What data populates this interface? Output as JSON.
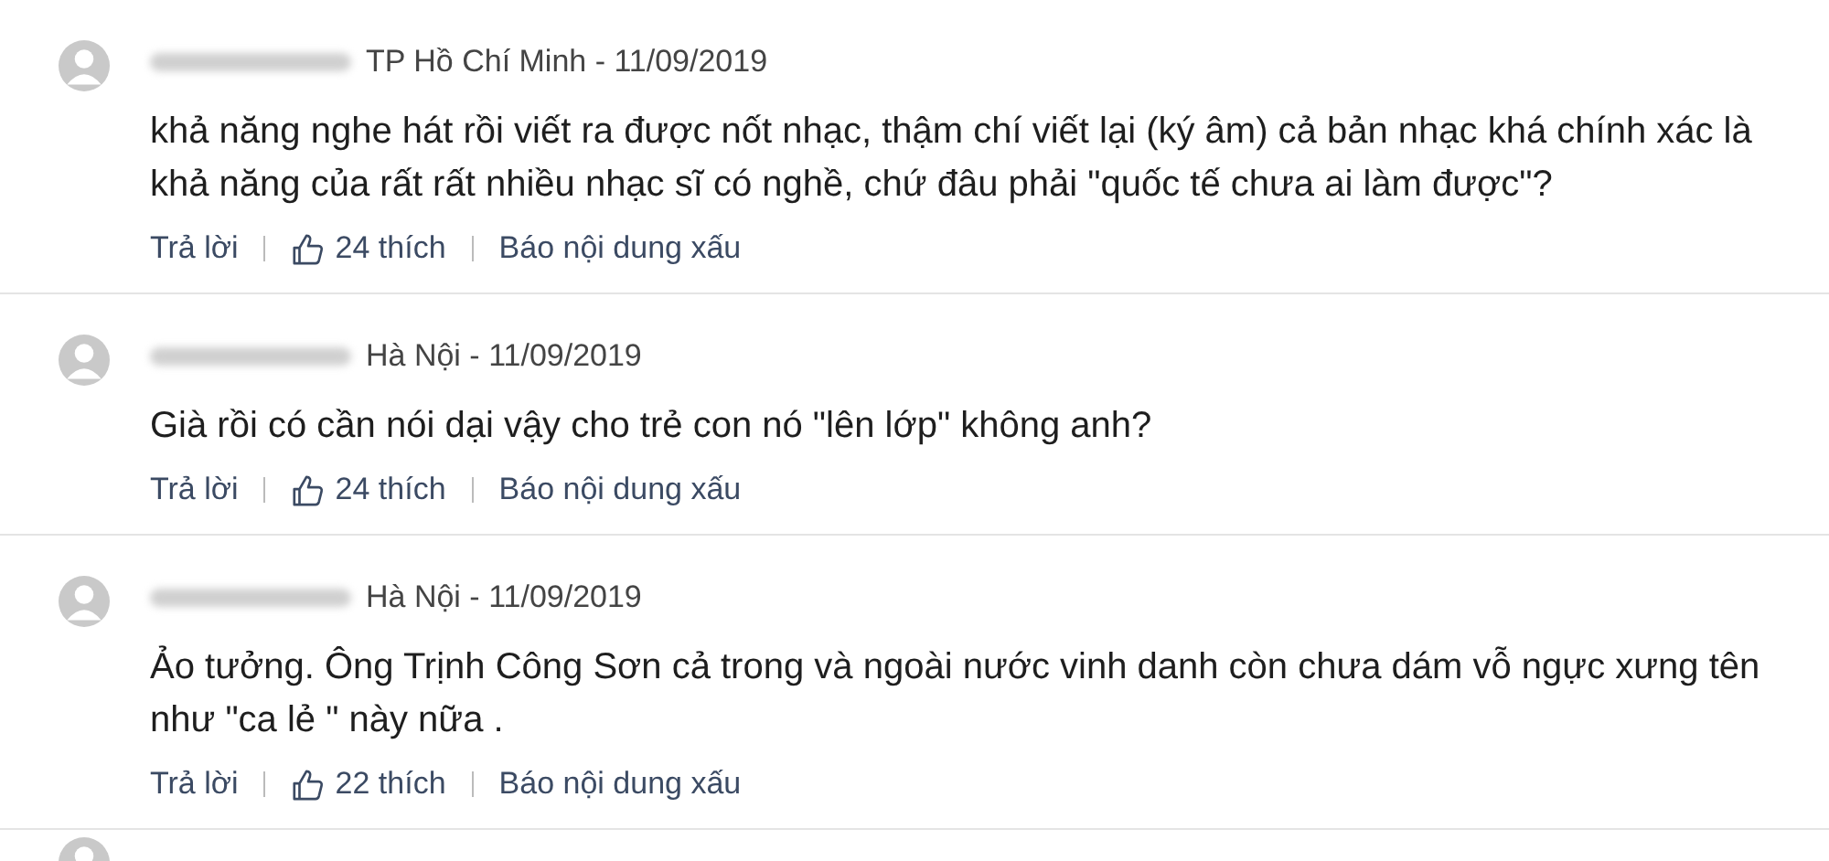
{
  "comments": [
    {
      "location": "TP Hồ Chí Minh - 11/09/2019",
      "text": "khả năng nghe hát rồi viết ra được nốt nhạc, thậm chí viết lại (ký âm) cả bản nhạc khá chính xác là khả năng của rất rất nhiều nhạc sĩ có nghề, chứ đâu phải \"quốc tế chưa ai làm được\"?",
      "reply": "Trả lời",
      "likes": "24 thích",
      "report": "Báo nội dung xấu"
    },
    {
      "location": "Hà Nội - 11/09/2019",
      "text": "Già rồi có cần nói dại vậy cho trẻ con nó \"lên lớp\" không anh?",
      "reply": "Trả lời",
      "likes": "24 thích",
      "report": "Báo nội dung xấu"
    },
    {
      "location": "Hà Nội - 11/09/2019",
      "text": "Ảo tưởng. Ông Trịnh Công Sơn cả trong và ngoài nước vinh danh còn chưa dám vỗ ngực xưng tên như \"ca lẻ \" này nữa .",
      "reply": "Trả lời",
      "likes": "22 thích",
      "report": "Báo nội dung xấu"
    }
  ]
}
